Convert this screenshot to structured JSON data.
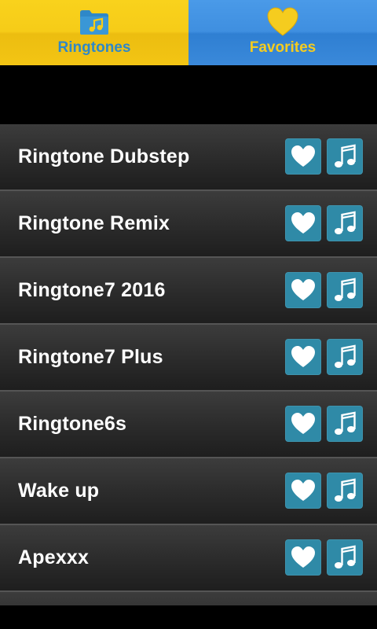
{
  "tabs": [
    {
      "label": "Ringtones",
      "icon": "folder-music-icon",
      "active": true,
      "bg": "#f6cc18",
      "label_color": "#2f88c8"
    },
    {
      "label": "Favorites",
      "icon": "heart-icon",
      "active": false,
      "bg": "#3f8fe0",
      "label_color": "#f5cc1f"
    }
  ],
  "list": {
    "items": [
      {
        "title": "Ringtone Dubstep"
      },
      {
        "title": "Ringtone Remix"
      },
      {
        "title": "Ringtone7 2016"
      },
      {
        "title": "Ringtone7 Plus"
      },
      {
        "title": "Ringtone6s"
      },
      {
        "title": "Wake up"
      },
      {
        "title": "Apexxx"
      },
      {
        "title": ""
      }
    ],
    "favorite_icon": "heart-icon",
    "play_icon": "music-note-icon",
    "button_color": "#2f8aa7"
  }
}
